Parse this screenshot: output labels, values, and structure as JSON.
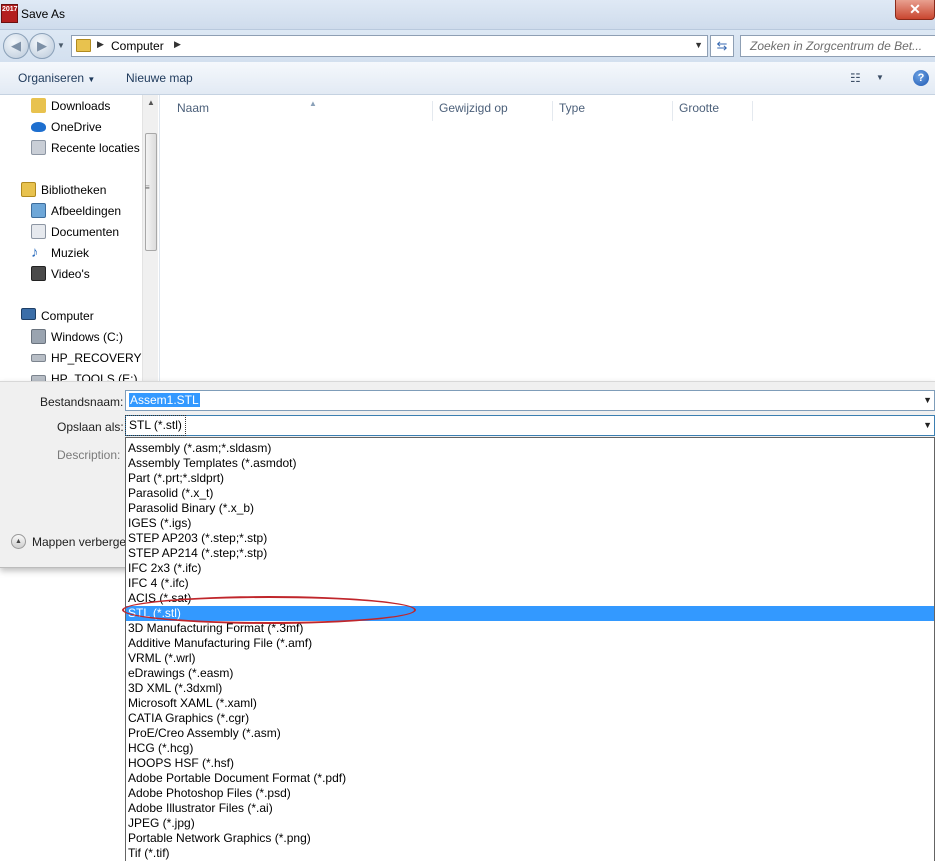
{
  "window": {
    "title": "Save As",
    "app_icon_text": "2017",
    "close_label": "✕"
  },
  "address": {
    "back_glyph": "◀",
    "forward_glyph": "▶",
    "breadcrumb": [
      "Computer"
    ],
    "search_placeholder": "Zoeken in Zorgcentrum de Bet..."
  },
  "toolbar": {
    "organise_label": "Organiseren",
    "new_folder_label": "Nieuwe map",
    "help_label": "?"
  },
  "nav_pane": {
    "items": [
      {
        "label": "Downloads",
        "icon": "downloads-folder-icon",
        "color": "#e8c24e"
      },
      {
        "label": "OneDrive",
        "icon": "onedrive-cloud-icon",
        "color": "#1e6fcf"
      },
      {
        "label": "Recente locaties",
        "icon": "recent-locations-icon",
        "color": "#c9ced6"
      },
      {
        "label": "Bibliotheken",
        "icon": "libraries-icon",
        "color": "#e8c24e"
      },
      {
        "label": "Afbeeldingen",
        "icon": "pictures-icon",
        "color": "#6ea7d8"
      },
      {
        "label": "Documenten",
        "icon": "documents-icon",
        "color": "#e6e9ee"
      },
      {
        "label": "Muziek",
        "icon": "music-icon",
        "color": "#2f6fbf"
      },
      {
        "label": "Video's",
        "icon": "videos-icon",
        "color": "#4a4a4a"
      },
      {
        "label": "Computer",
        "icon": "computer-icon",
        "color": "#3b6ea8"
      },
      {
        "label": "Windows (C:)",
        "icon": "windows-drive-icon",
        "color": "#9aa4b0"
      },
      {
        "label": "HP_RECOVERY (D",
        "icon": "drive-icon",
        "color": "#b8bec6"
      },
      {
        "label": "HP_TOOLS (E:)",
        "icon": "drive-icon",
        "color": "#b8bec6"
      }
    ]
  },
  "file_list": {
    "columns": [
      "Naam",
      "Gewijzigd op",
      "Type",
      "Grootte"
    ]
  },
  "form": {
    "filename_label": "Bestandsnaam:",
    "filename_value": "Assem1.STL",
    "filetype_label": "Opslaan als:",
    "filetype_value": "STL (*.stl)",
    "description_label": "Description:",
    "hide_folders_label": "Mappen verberge"
  },
  "file_types": {
    "selected_index": 11,
    "options": [
      "Assembly (*.asm;*.sldasm)",
      "Assembly Templates (*.asmdot)",
      "Part (*.prt;*.sldprt)",
      "Parasolid (*.x_t)",
      "Parasolid Binary (*.x_b)",
      "IGES (*.igs)",
      "STEP AP203 (*.step;*.stp)",
      "STEP AP214 (*.step;*.stp)",
      "IFC 2x3 (*.ifc)",
      "IFC 4 (*.ifc)",
      "ACIS (*.sat)",
      "STL (*.stl)",
      "3D Manufacturing Format (*.3mf)",
      "Additive Manufacturing File (*.amf)",
      "VRML (*.wrl)",
      "eDrawings (*.easm)",
      "3D XML (*.3dxml)",
      "Microsoft XAML (*.xaml)",
      "CATIA Graphics (*.cgr)",
      "ProE/Creo Assembly (*.asm)",
      "HCG (*.hcg)",
      "HOOPS HSF (*.hsf)",
      "Adobe Portable Document Format (*.pdf)",
      "Adobe Photoshop Files  (*.psd)",
      "Adobe Illustrator Files (*.ai)",
      "JPEG (*.jpg)",
      "Portable Network Graphics (*.png)",
      "Tif (*.tif)"
    ]
  },
  "colors": {
    "selection": "#3399ff",
    "annotation_ring": "#c0262b"
  }
}
